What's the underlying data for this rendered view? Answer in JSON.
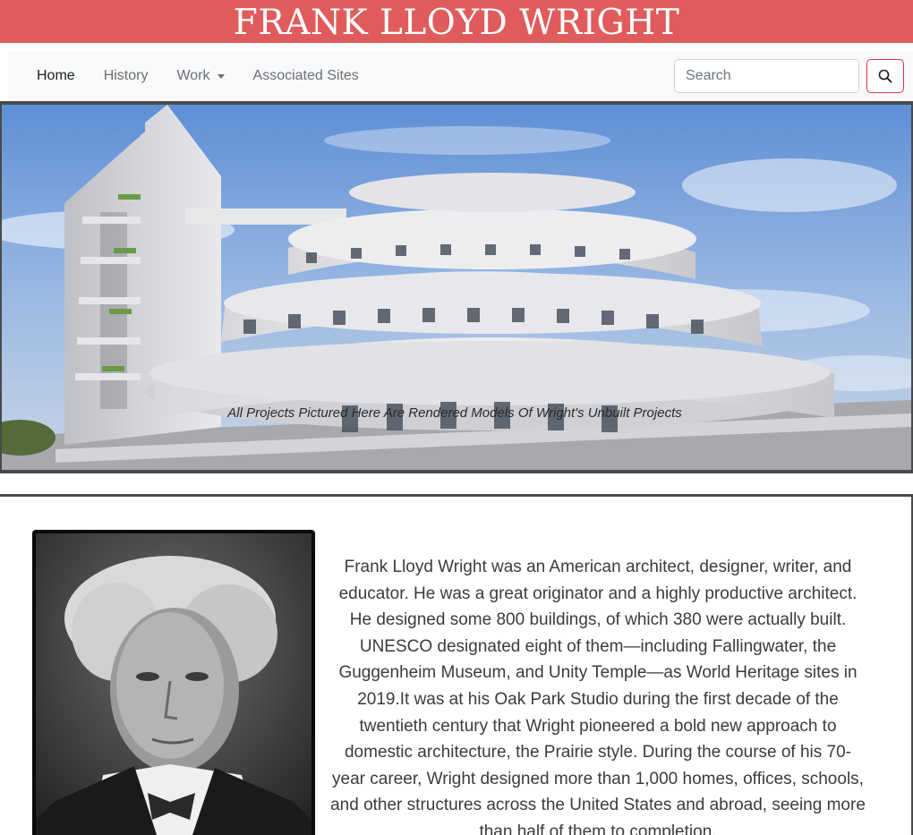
{
  "header": {
    "title": "FRANK LLOYD WRIGHT"
  },
  "nav": {
    "items": [
      {
        "label": "Home"
      },
      {
        "label": "History"
      },
      {
        "label": "Work"
      },
      {
        "label": "Associated Sites"
      }
    ],
    "search_placeholder": "Search",
    "search_icon": "magnifier-icon"
  },
  "hero": {
    "caption": "All Projects Pictured Here Are Rendered Models Of Wright's Unbuilt Projects",
    "image": "rendered-spiral-building"
  },
  "about": {
    "portrait": "frank-lloyd-wright-portrait",
    "text": "Frank Lloyd Wright was an American architect, designer, writer, and educator. He was a great originator and a highly productive architect. He designed some 800 buildings, of which 380 were actually built. UNESCO designated eight of them—including Fallingwater, the Guggenheim Museum, and Unity Temple—as World Heritage sites in 2019.It was at his Oak Park Studio during the first decade of the twentieth century that Wright pioneered a bold new approach to domestic architecture, the Prairie style. During the course of his 70-year career, Wright designed more than 1,000 homes, offices, schools, and other structures across the United States and abroad, seeing more than half of them to completion."
  },
  "colors": {
    "banner": "#e05c5c",
    "navbar_bg": "#f8f9fa",
    "search_button_border": "#dc3545"
  }
}
